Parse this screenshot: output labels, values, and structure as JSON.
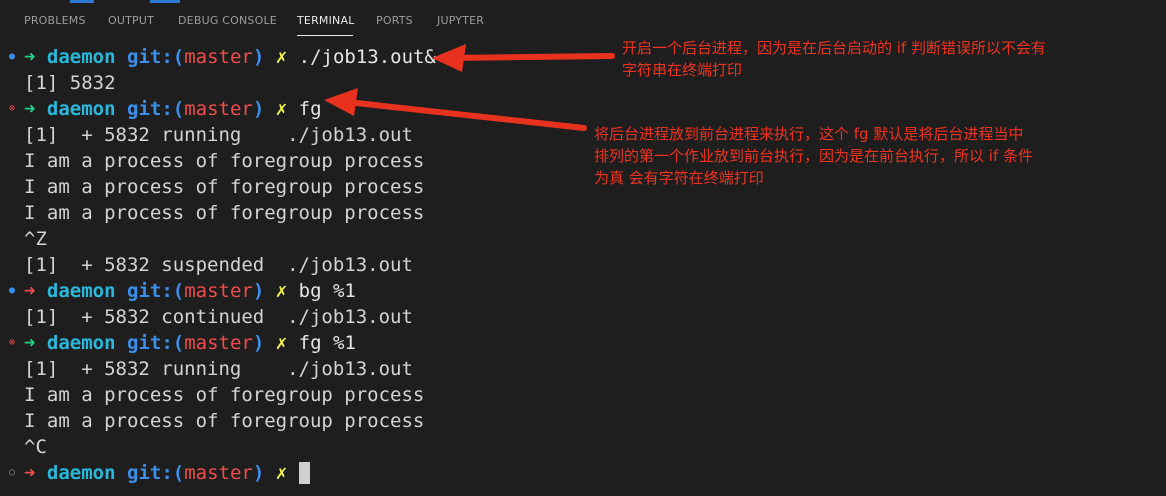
{
  "tabs": [
    {
      "label": "PROBLEMS"
    },
    {
      "label": "OUTPUT"
    },
    {
      "label": "DEBUG CONSOLE"
    },
    {
      "label": "TERMINAL"
    },
    {
      "label": "PORTS"
    },
    {
      "label": "JUPYTER"
    }
  ],
  "active_tab": "TERMINAL",
  "prompt": {
    "arrow": "➜",
    "dir": "daemon",
    "git_open": "git:(",
    "branch": "master",
    "git_close": ")",
    "dirty_mark": "✗"
  },
  "terminal": {
    "commands": [
      "./job13.out&",
      "fg",
      "bg %1",
      "fg %1"
    ],
    "output": [
      "[1] 5832",
      "[1]  + 5832 running    ./job13.out",
      "I am a process of foregroup process",
      "I am a process of foregroup process",
      "I am a process of foregroup process",
      "^Z",
      "[1]  + 5832 suspended  ./job13.out",
      "[1]  + 5832 continued  ./job13.out",
      "[1]  + 5832 running    ./job13.out",
      "I am a process of foregroup process",
      "I am a process of foregroup process",
      "^C"
    ]
  },
  "annotations": [
    {
      "lines": [
        "开启一个后台进程，因为是在后台启动的 if 判断错误所以不会有",
        "字符串在终端打印"
      ]
    },
    {
      "lines": [
        "将后台进程放到前台进程来执行，这个 fg 默认是将后台进程当中",
        "排列的第一个作业放到前台执行，因为是在前台执行，所以 if 条件",
        "为真 会有字符在终端打印"
      ]
    }
  ],
  "colors": {
    "background": "#1e1e1e",
    "prompt_arrow_success": "#23d18b",
    "prompt_arrow_error": "#f14c4c",
    "dir": "#29b8db",
    "git": "#3b8eea",
    "branch": "#f14c4c",
    "dirty_mark": "#f5f543",
    "annotation": "#f0321e"
  },
  "icons": {
    "status_success": "circle-dot-icon",
    "status_error": "error-circle-x-icon",
    "status_default": "hollow-circle-icon",
    "annotation_arrow": "red-arrow-icon"
  }
}
